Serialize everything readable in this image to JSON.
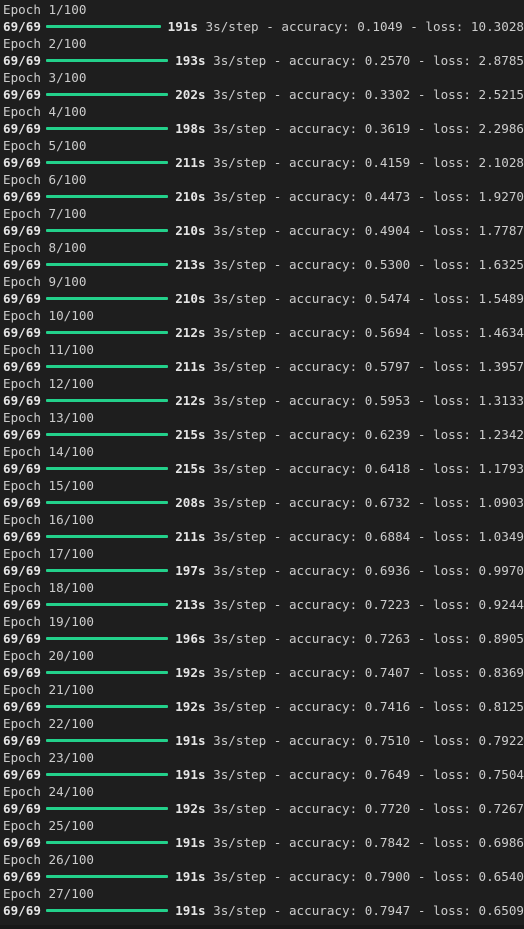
{
  "terminal": {
    "colors": {
      "background": "#1e1e1e",
      "text": "#cccccc",
      "progress_bar": "#23d18b"
    },
    "epochs": [
      {
        "header": "Epoch 1/100",
        "steps": "69/69",
        "time": "191s",
        "step_time": "3s/step",
        "accuracy": "0.1049",
        "loss": "10.3028"
      },
      {
        "header": "Epoch 2/100",
        "steps": "69/69",
        "time": "193s",
        "step_time": "3s/step",
        "accuracy": "0.2570",
        "loss": "2.8785"
      },
      {
        "header": "Epoch 3/100",
        "steps": "69/69",
        "time": "202s",
        "step_time": "3s/step",
        "accuracy": "0.3302",
        "loss": "2.5215"
      },
      {
        "header": "Epoch 4/100",
        "steps": "69/69",
        "time": "198s",
        "step_time": "3s/step",
        "accuracy": "0.3619",
        "loss": "2.2986"
      },
      {
        "header": "Epoch 5/100",
        "steps": "69/69",
        "time": "211s",
        "step_time": "3s/step",
        "accuracy": "0.4159",
        "loss": "2.1028"
      },
      {
        "header": "Epoch 6/100",
        "steps": "69/69",
        "time": "210s",
        "step_time": "3s/step",
        "accuracy": "0.4473",
        "loss": "1.9270"
      },
      {
        "header": "Epoch 7/100",
        "steps": "69/69",
        "time": "210s",
        "step_time": "3s/step",
        "accuracy": "0.4904",
        "loss": "1.7787"
      },
      {
        "header": "Epoch 8/100",
        "steps": "69/69",
        "time": "213s",
        "step_time": "3s/step",
        "accuracy": "0.5300",
        "loss": "1.6325"
      },
      {
        "header": "Epoch 9/100",
        "steps": "69/69",
        "time": "210s",
        "step_time": "3s/step",
        "accuracy": "0.5474",
        "loss": "1.5489"
      },
      {
        "header": "Epoch 10/100",
        "steps": "69/69",
        "time": "212s",
        "step_time": "3s/step",
        "accuracy": "0.5694",
        "loss": "1.4634"
      },
      {
        "header": "Epoch 11/100",
        "steps": "69/69",
        "time": "211s",
        "step_time": "3s/step",
        "accuracy": "0.5797",
        "loss": "1.3957"
      },
      {
        "header": "Epoch 12/100",
        "steps": "69/69",
        "time": "212s",
        "step_time": "3s/step",
        "accuracy": "0.5953",
        "loss": "1.3133"
      },
      {
        "header": "Epoch 13/100",
        "steps": "69/69",
        "time": "215s",
        "step_time": "3s/step",
        "accuracy": "0.6239",
        "loss": "1.2342"
      },
      {
        "header": "Epoch 14/100",
        "steps": "69/69",
        "time": "215s",
        "step_time": "3s/step",
        "accuracy": "0.6418",
        "loss": "1.1793"
      },
      {
        "header": "Epoch 15/100",
        "steps": "69/69",
        "time": "208s",
        "step_time": "3s/step",
        "accuracy": "0.6732",
        "loss": "1.0903"
      },
      {
        "header": "Epoch 16/100",
        "steps": "69/69",
        "time": "211s",
        "step_time": "3s/step",
        "accuracy": "0.6884",
        "loss": "1.0349"
      },
      {
        "header": "Epoch 17/100",
        "steps": "69/69",
        "time": "197s",
        "step_time": "3s/step",
        "accuracy": "0.6936",
        "loss": "0.9970"
      },
      {
        "header": "Epoch 18/100",
        "steps": "69/69",
        "time": "213s",
        "step_time": "3s/step",
        "accuracy": "0.7223",
        "loss": "0.9244"
      },
      {
        "header": "Epoch 19/100",
        "steps": "69/69",
        "time": "196s",
        "step_time": "3s/step",
        "accuracy": "0.7263",
        "loss": "0.8905"
      },
      {
        "header": "Epoch 20/100",
        "steps": "69/69",
        "time": "192s",
        "step_time": "3s/step",
        "accuracy": "0.7407",
        "loss": "0.8369"
      },
      {
        "header": "Epoch 21/100",
        "steps": "69/69",
        "time": "192s",
        "step_time": "3s/step",
        "accuracy": "0.7416",
        "loss": "0.8125"
      },
      {
        "header": "Epoch 22/100",
        "steps": "69/69",
        "time": "191s",
        "step_time": "3s/step",
        "accuracy": "0.7510",
        "loss": "0.7922"
      },
      {
        "header": "Epoch 23/100",
        "steps": "69/69",
        "time": "191s",
        "step_time": "3s/step",
        "accuracy": "0.7649",
        "loss": "0.7504"
      },
      {
        "header": "Epoch 24/100",
        "steps": "69/69",
        "time": "192s",
        "step_time": "3s/step",
        "accuracy": "0.7720",
        "loss": "0.7267"
      },
      {
        "header": "Epoch 25/100",
        "steps": "69/69",
        "time": "191s",
        "step_time": "3s/step",
        "accuracy": "0.7842",
        "loss": "0.6986"
      },
      {
        "header": "Epoch 26/100",
        "steps": "69/69",
        "time": "191s",
        "step_time": "3s/step",
        "accuracy": "0.7900",
        "loss": "0.6540"
      },
      {
        "header": "Epoch 27/100",
        "steps": "69/69",
        "time": "191s",
        "step_time": "3s/step",
        "accuracy": "0.7947",
        "loss": "0.6509"
      }
    ]
  }
}
